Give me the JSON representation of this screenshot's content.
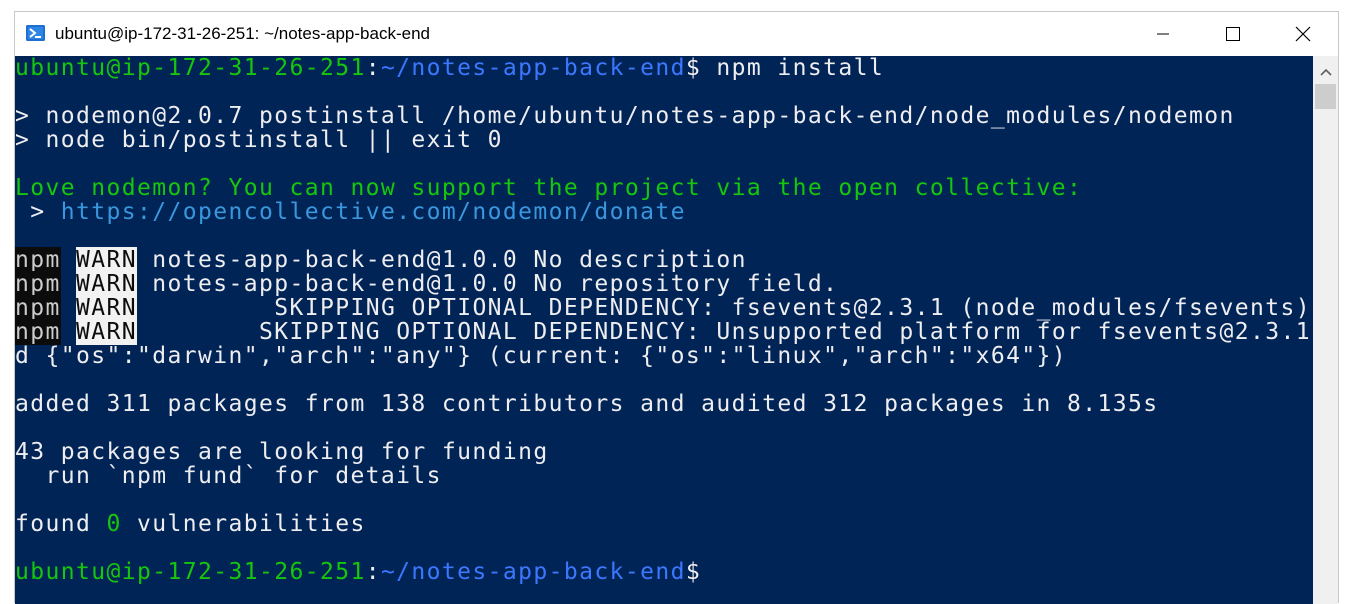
{
  "window": {
    "title": "ubuntu@ip-172-31-26-251: ~/notes-app-back-end",
    "icon": "terminal-icon",
    "controls": [
      "minimize-icon",
      "maximize-icon",
      "close-icon"
    ]
  },
  "colors": {
    "console_bg": "#012456",
    "prompt_user": "#16c60c",
    "prompt_path": "#3b78ff",
    "link": "#3a96dd",
    "text": "#eeedf0"
  },
  "terminal": {
    "prompt1": {
      "user": "ubuntu@ip-172-31-26-251",
      "colon": ":",
      "path": "~/notes-app-back-end",
      "symbol": "$",
      "command": " npm install"
    },
    "postinstall_1": "> nodemon@2.0.7 postinstall /home/ubuntu/notes-app-back-end/node_modules/nodemon",
    "postinstall_2": "> node bin/postinstall || exit 0",
    "love_line": "Love nodemon? You can now support the project via the open collective:",
    "donate_prefix": " > ",
    "donate_url": "https://opencollective.com/nodemon/donate",
    "warnings": [
      {
        "npm": "npm",
        "level": "WARN",
        "text": " notes-app-back-end@1.0.0 No description"
      },
      {
        "npm": "npm",
        "level": "WARN",
        "text": " notes-app-back-end@1.0.0 No repository field."
      },
      {
        "npm": "npm",
        "level": "WARN",
        "text": "         SKIPPING OPTIONAL DEPENDENCY: fsevents@2.3.1 (node_modules/fsevents):"
      },
      {
        "npm": "npm",
        "level": "WARN",
        "text": "        SKIPPING OPTIONAL DEPENDENCY: Unsupported platform for fsevents@2.3.1: wante"
      }
    ],
    "warn_continuation": "d {\"os\":\"darwin\",\"arch\":\"any\"} (current: {\"os\":\"linux\",\"arch\":\"x64\"})",
    "added_line": "added 311 packages from 138 contributors and audited 312 packages in 8.135s",
    "funding_line": "43 packages are looking for funding",
    "fund_hint": "  run `npm fund` for details",
    "found_prefix": "found ",
    "found_count": "0",
    "found_suffix": " vulnerabilities",
    "prompt2": {
      "user": "ubuntu@ip-172-31-26-251",
      "colon": ":",
      "path": "~/notes-app-back-end",
      "symbol": "$"
    }
  }
}
